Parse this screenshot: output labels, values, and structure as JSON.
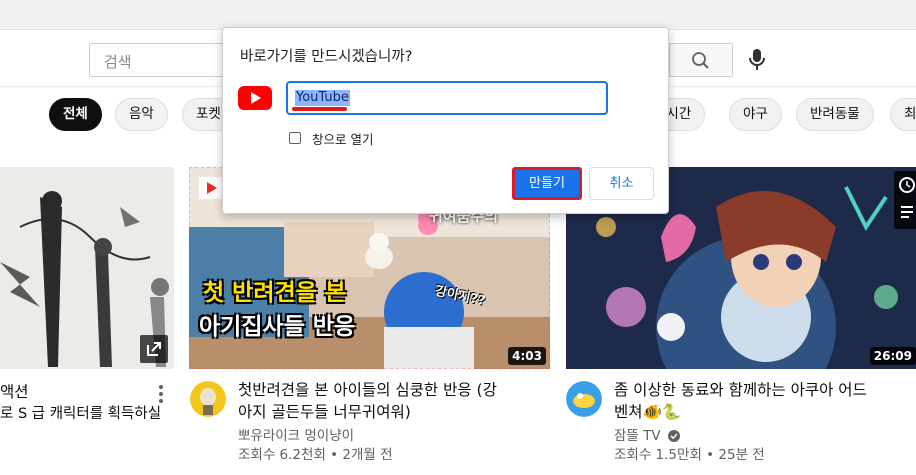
{
  "masthead": {
    "search_placeholder": "검색"
  },
  "chips": [
    {
      "label": "전체",
      "active": true
    },
    {
      "label": "음악",
      "active": false
    },
    {
      "label": "포켓",
      "active": false
    },
    {
      "label": "실시간",
      "active": false
    },
    {
      "label": "야구",
      "active": false
    },
    {
      "label": "반려동물",
      "active": false
    },
    {
      "label": "최",
      "active": false
    }
  ],
  "videos": [
    {
      "title_line1": "액션",
      "title_line2": "로 S 급 캐릭터를 획득하실",
      "overlay_icon": "open-external-icon"
    },
    {
      "thumb_text_top": "귀여움주의",
      "thumb_text_line1": "첫 반려견을 본",
      "thumb_text_line2": "아기집사들 반응",
      "thumb_text_right": "강아지??",
      "duration": "4:03",
      "title_line1": "첫반려견을 본 아이들의 심쿵한 반응 (강",
      "title_line2": "아지 골든두들 너무귀여워)",
      "channel": "뽀유라이크 멍이냥이",
      "meta": "조회수 6.2천회 • 2개월 전"
    },
    {
      "duration": "26:09",
      "title_line1": "좀 이상한 동료와 함께하는 아쿠아 어드",
      "title_line2": "벤쳐🐠🐍",
      "channel": "잠뜰 TV",
      "meta": "조회수 1.5만회 • 25분 전",
      "verified": true
    }
  ],
  "dialog": {
    "title": "바로가기를 만드시겠습니까?",
    "name_value": "YouTube",
    "open_as_window_label": "창으로 열기",
    "open_as_window_checked": false,
    "create_label": "만들기",
    "cancel_label": "취소"
  },
  "colors": {
    "accent_blue": "#1a73e8",
    "youtube_red": "#ff0000",
    "highlight_red": "#e0192a"
  }
}
